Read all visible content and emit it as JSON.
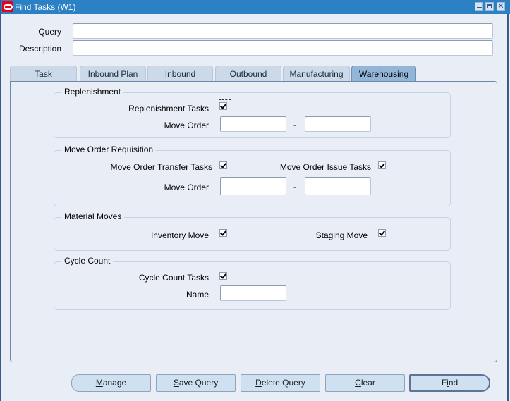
{
  "window": {
    "title": "Find Tasks (W1)",
    "controls": [
      "minimize",
      "maximize",
      "close"
    ]
  },
  "header_fields": {
    "query": {
      "label": "Query",
      "value": ""
    },
    "description": {
      "label": "Description",
      "value": ""
    }
  },
  "tabs": [
    {
      "label": "Task",
      "active": false
    },
    {
      "label": "Inbound Plan",
      "active": false
    },
    {
      "label": "Inbound",
      "active": false
    },
    {
      "label": "Outbound",
      "active": false
    },
    {
      "label": "Manufacturing",
      "active": false
    },
    {
      "label": "Warehousing",
      "active": true
    }
  ],
  "groups": {
    "replenishment": {
      "title": "Replenishment",
      "tasks_label": "Replenishment Tasks",
      "tasks_checked": true,
      "move_order_label": "Move Order",
      "move_order_from": "",
      "move_order_to": "",
      "range_separator": "-"
    },
    "move_order_requisition": {
      "title": "Move Order Requisition",
      "transfer_label": "Move Order Transfer Tasks",
      "transfer_checked": true,
      "issue_label": "Move Order Issue Tasks",
      "issue_checked": true,
      "move_order_label": "Move Order",
      "move_order_from": "",
      "move_order_to": "",
      "range_separator": "-"
    },
    "material_moves": {
      "title": "Material Moves",
      "inventory_label": "Inventory Move",
      "inventory_checked": true,
      "staging_label": "Staging Move",
      "staging_checked": true
    },
    "cycle_count": {
      "title": "Cycle Count",
      "tasks_label": "Cycle Count Tasks",
      "tasks_checked": true,
      "name_label": "Name",
      "name_value": ""
    }
  },
  "buttons": {
    "manage": {
      "mnemonic": "M",
      "rest": "anage"
    },
    "save_query": {
      "mnemonic": "S",
      "rest": "ave Query"
    },
    "delete_query": {
      "mnemonic": "D",
      "rest": "elete Query"
    },
    "clear": {
      "mnemonic": "C",
      "rest": "lear"
    },
    "find": {
      "pre": "F",
      "mnemonic": "i",
      "rest": "nd"
    }
  }
}
